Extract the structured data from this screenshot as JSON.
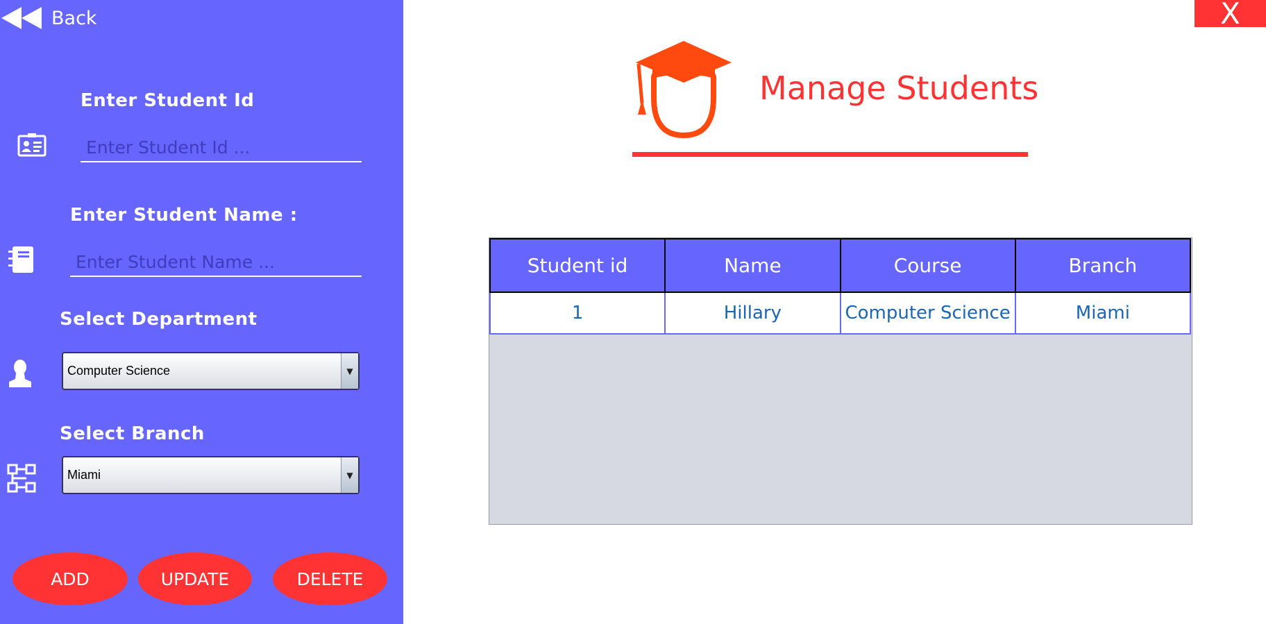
{
  "nav": {
    "back_label": "Back",
    "close_label": "X"
  },
  "page": {
    "title": "Manage Students"
  },
  "form": {
    "student_id_label": "Enter Student Id",
    "student_id_placeholder": "Enter Student Id ...",
    "student_id_value": "",
    "student_name_label": "Enter Student Name :",
    "student_name_placeholder": "Enter Student Name ...",
    "student_name_value": "",
    "department_label": "Select Department",
    "department_value": "Computer Science",
    "branch_label": "Select Branch",
    "branch_value": "Miami"
  },
  "actions": {
    "add": "ADD",
    "update": "UPDATE",
    "delete": "DELETE"
  },
  "table": {
    "headers": [
      "Student id",
      "Name",
      "Course",
      "Branch"
    ],
    "rows": [
      [
        "1",
        "Hillary",
        "Computer Science",
        "Miami"
      ]
    ]
  },
  "icons": {
    "back": "rewind-icon",
    "student_id": "id-card-icon",
    "student_name": "notebook-icon",
    "department": "user-icon",
    "branch": "hierarchy-icon",
    "logo": "graduate-cap-icon"
  },
  "colors": {
    "sidebar": "#6666ff",
    "accent": "#ff3333",
    "logo": "#ff4a0f",
    "table_header": "#6666ff",
    "table_cell_text": "#1a66b3",
    "table_empty": "#d6d9e2"
  }
}
